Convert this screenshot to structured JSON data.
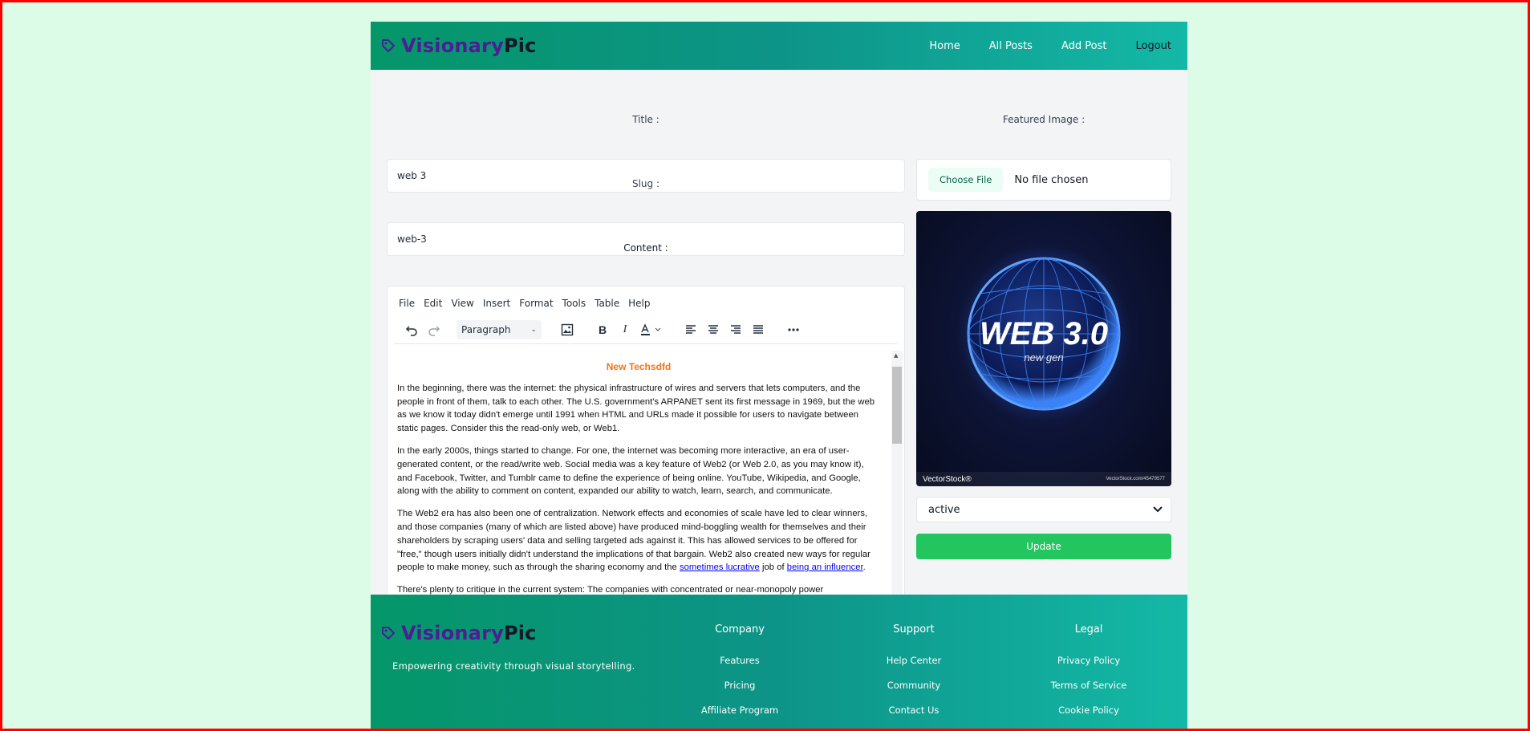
{
  "colors": {
    "header_gradient": [
      "#059669",
      "#14b8a6"
    ],
    "brand_primary": "#4c1d95",
    "content_title": "#f97316",
    "update_button": "#22c55e",
    "page_background": "#dcfce7"
  },
  "navbar": {
    "brand": {
      "part1": "Visionary",
      "part2": "Pic",
      "icon": "tag-icon"
    },
    "links": [
      "Home",
      "All Posts",
      "Add Post",
      "Logout"
    ]
  },
  "form": {
    "title_label": "Title :",
    "title_value": "web 3",
    "slug_label": "Slug :",
    "slug_value": "web-3",
    "content_label": "Content :",
    "featured_label": "Featured Image :",
    "choose_file": "Choose File",
    "no_file": "No file chosen",
    "status_value": "active",
    "update_label": "Update"
  },
  "editor": {
    "menu": [
      "File",
      "Edit",
      "View",
      "Insert",
      "Format",
      "Tools",
      "Table",
      "Help"
    ],
    "block_format": "Paragraph",
    "toolbar_icons": [
      "undo-icon",
      "redo-icon",
      "image-icon",
      "bold-icon",
      "italic-icon",
      "text-color-icon",
      "align-left-icon",
      "align-center-icon",
      "align-right-icon",
      "align-justify-icon",
      "more-icon"
    ],
    "content": {
      "heading": "New Techsdfd",
      "p1": "In the beginning, there was the internet: the physical infrastructure of wires and servers that lets computers, and the people in front of them, talk to each other. The U.S. government's ARPANET sent its first message in 1969, but the web as we know it today didn't emerge until 1991 when HTML and URLs made it possible for users to navigate between static pages. Consider this the read-only web, or Web1.",
      "p2": "In the early 2000s, things started to change. For one, the internet was becoming more interactive, an era of user-generated content, or the read/write web. Social media was a key feature of Web2 (or Web 2.0, as you may know it), and Facebook, Twitter, and Tumblr came to define the experience of being online. YouTube, Wikipedia, and Google, along with the ability to comment on content, expanded our ability to watch, learn, search, and communicate.",
      "p3_text": "The Web2 era has also been one of centralization. Network effects and economies of scale have led to clear winners, and those companies (many of which are listed above) have produced mind-boggling wealth for themselves and their shareholders by scraping users' data and selling targeted ads against it. This has allowed services to be offered for \"free,\" though users initially didn't understand the implications of that bargain. Web2 also created new ways for regular people to make money, such as through the sharing economy and the ",
      "p3_link1": "sometimes lucrative",
      "p3_mid": " job of ",
      "p3_link2": "being an influencer",
      "p3_end": ".",
      "p4": "There's plenty to critique in the current system: The companies with concentrated or near-monopoly power"
    }
  },
  "preview": {
    "headline": "WEB 3.0",
    "subline": "new gen",
    "watermark": "VectorStock®",
    "watermark_url": "VectorStock.com/45479577"
  },
  "footer": {
    "brand": {
      "part1": "Visionary",
      "part2": "Pic"
    },
    "tagline": "Empowering creativity through visual storytelling.",
    "columns": [
      {
        "title": "Company",
        "links": [
          "Features",
          "Pricing",
          "Affiliate Program"
        ]
      },
      {
        "title": "Support",
        "links": [
          "Help Center",
          "Community",
          "Contact Us"
        ]
      },
      {
        "title": "Legal",
        "links": [
          "Privacy Policy",
          "Terms of Service",
          "Cookie Policy"
        ]
      }
    ]
  }
}
